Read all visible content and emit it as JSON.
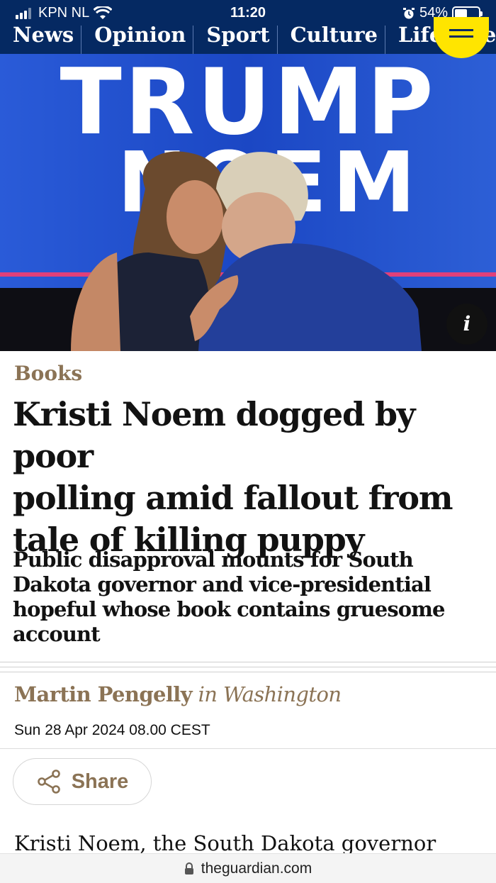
{
  "status_bar": {
    "carrier": "KPN NL",
    "time": "11:20",
    "battery": "54%",
    "battery_level": 0.54
  },
  "nav": {
    "items": [
      "News",
      "Opinion",
      "Sport",
      "Culture",
      "Lifestyle"
    ]
  },
  "hero": {
    "sign_line_1": "TRUMP",
    "sign_line_2": "NOEM",
    "info_label": "i"
  },
  "article": {
    "kicker": "Books",
    "headline_lines": [
      "Kristi Noem dogged by poor",
      "polling amid fallout from",
      "tale of killing puppy"
    ],
    "standfirst_lines": [
      "Public disapproval mounts for South",
      "Dakota governor and vice-presidential",
      "hopeful whose book contains gruesome",
      "account"
    ],
    "byline_name": "Martin Pengelly",
    "byline_location": "in Washington",
    "date": "Sun 28 Apr 2024 08.00 CEST",
    "share_label": "Share",
    "body_start": "Kristi Noem, the South Dakota governor"
  },
  "browser": {
    "url": "theguardian.com"
  },
  "colors": {
    "guardian_blue": "#052962",
    "menu_yellow": "#ffe500",
    "kicker_brown": "#8b7355"
  },
  "icons": [
    "signal-icon",
    "wifi-icon",
    "alarm-icon",
    "battery-icon",
    "menu-icon",
    "info-icon",
    "share-icon",
    "lock-icon"
  ]
}
